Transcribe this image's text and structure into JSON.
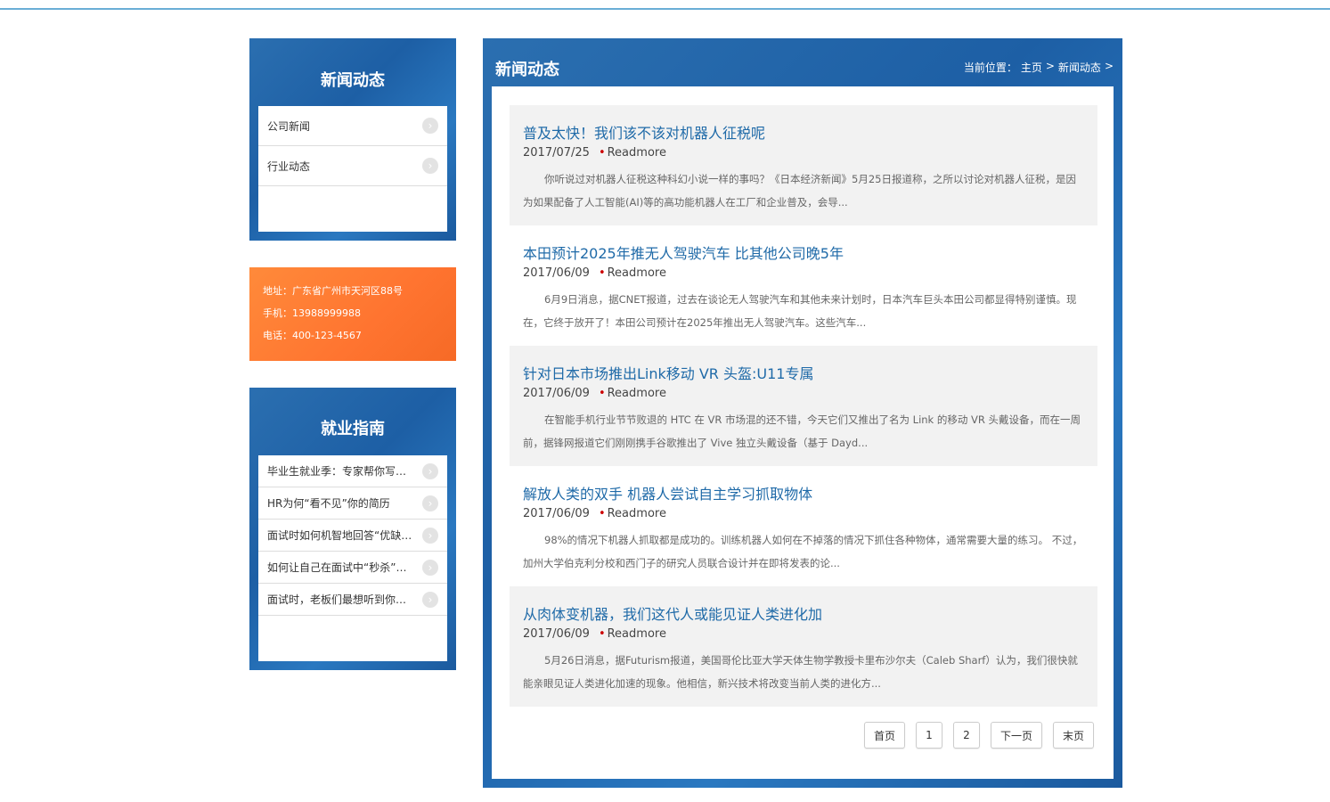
{
  "sidebar_news": {
    "title": "新闻动态",
    "items": [
      {
        "label": "公司新闻"
      },
      {
        "label": "行业动态"
      }
    ]
  },
  "contact": {
    "address": "地址：广东省广州市天河区88号",
    "mobile": "手机：13988999988",
    "phone": "电话：400-123-4567"
  },
  "sidebar_jobs": {
    "title": "就业指南",
    "items": [
      {
        "label": "毕业生就业季：专家帮你写求职信"
      },
      {
        "label": "HR为何“看不见”你的简历"
      },
      {
        "label": "面试时如何机智地回答“优缺点”"
      },
      {
        "label": "如何让自己在面试中“秒杀”对手"
      },
      {
        "label": "面试时，老板们最想听到你问什么"
      }
    ]
  },
  "main": {
    "title": "新闻动态",
    "breadcrumb": {
      "prefix": "当前位置：",
      "home": "主页",
      "sep": ">",
      "current": "新闻动态"
    },
    "articles": [
      {
        "title": "普及太快！我们该不该对机器人征税呢",
        "date": "2017/07/25",
        "more": "Readmore",
        "summary": "你听说过对机器人征税这种科幻小说一样的事吗？《日本经济新闻》5月25日报道称，之所以讨论对机器人征税，是因为如果配备了人工智能(AI)等的高功能机器人在工厂和企业普及，会导..."
      },
      {
        "title": "本田预计2025年推无人驾驶汽车 比其他公司晚5年",
        "date": "2017/06/09",
        "more": "Readmore",
        "summary": "6月9日消息，据CNET报道，过去在谈论无人驾驶汽车和其他未来计划时，日本汽车巨头本田公司都显得特别谨慎。现在，它终于放开了！本田公司预计在2025年推出无人驾驶汽车。这些汽车..."
      },
      {
        "title": "针对日本市场推出Link移动 VR 头盔:U11专属",
        "date": "2017/06/09",
        "more": "Readmore",
        "summary": "在智能手机行业节节败退的 HTC 在 VR 市场混的还不错，今天它们又推出了名为 Link 的移动 VR 头戴设备，而在一周前，据锋网报道它们刚刚携手谷歌推出了 Vive 独立头戴设备（基于 Dayd..."
      },
      {
        "title": "解放人类的双手 机器人尝试自主学习抓取物体",
        "date": "2017/06/09",
        "more": "Readmore",
        "summary": "98%的情况下机器人抓取都是成功的。训练机器人如何在不掉落的情况下抓住各种物体，通常需要大量的练习。 不过，加州大学伯克利分校和西门子的研究人员联合设计并在即将发表的论..."
      },
      {
        "title": "从肉体变机器，我们这代人或能见证人类进化加",
        "date": "2017/06/09",
        "more": "Readmore",
        "summary": "5月26日消息，据Futurism报道，美国哥伦比亚大学天体生物学教授卡里布沙尔夫（Caleb Sharf）认为，我们很快就能亲眼见证人类进化加速的现象。他相信，新兴技术将改变当前人类的进化方..."
      }
    ],
    "pagination": {
      "first": "首页",
      "page1": "1",
      "page2": "2",
      "next": "下一页",
      "last": "末页"
    }
  },
  "colors": {
    "panel_blue": "#1d5fa5",
    "contact_orange": "#ff7a30",
    "title_link": "#1f6aa8"
  }
}
